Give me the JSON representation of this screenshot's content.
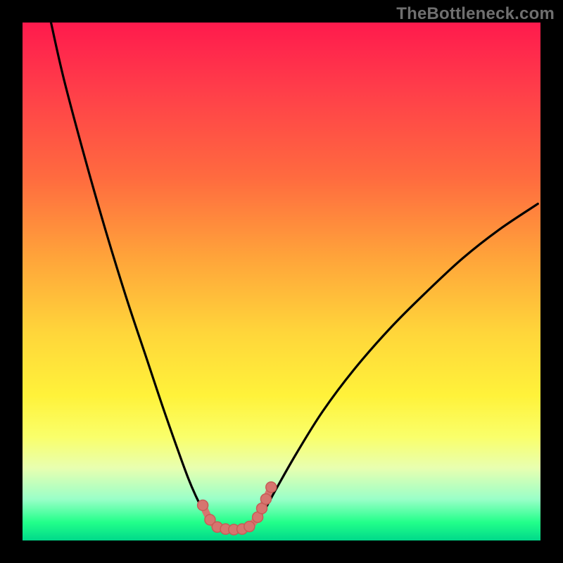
{
  "watermark": "TheBottleneck.com",
  "colors": {
    "curve": "#000000",
    "markers_fill": "#d6756f",
    "markers_stroke": "#c75c57",
    "marker_line": "#d6756f"
  },
  "chart_data": {
    "type": "line",
    "title": "",
    "xlabel": "",
    "ylabel": "",
    "xlim": [
      0,
      100
    ],
    "ylim": [
      0,
      100
    ],
    "grid": false,
    "series": [
      {
        "name": "left-branch",
        "x": [
          5.5,
          8,
          12,
          16,
          20,
          24,
          27,
          29.8,
          32,
          33.5,
          35,
          36.2,
          37.5
        ],
        "y": [
          100,
          89,
          74,
          60,
          47,
          35,
          26,
          18,
          12,
          8.5,
          5.5,
          3.5,
          2.5
        ]
      },
      {
        "name": "floor",
        "x": [
          37.5,
          38.5,
          40,
          41.5,
          43,
          44.5
        ],
        "y": [
          2.5,
          2.2,
          2.1,
          2.1,
          2.2,
          2.8
        ]
      },
      {
        "name": "right-branch",
        "x": [
          44.5,
          46.5,
          49,
          53,
          58,
          64,
          71,
          78,
          85,
          92,
          99.5
        ],
        "y": [
          2.8,
          5.5,
          10,
          17,
          25,
          33,
          41,
          48,
          54.5,
          60,
          65
        ]
      }
    ],
    "markers": {
      "name": "highlight-points",
      "x": [
        34.8,
        36.2,
        37.6,
        39.2,
        40.8,
        42.4,
        43.8,
        45.4,
        46.2,
        47.0,
        48.0
      ],
      "y": [
        6.8,
        4.0,
        2.6,
        2.2,
        2.1,
        2.2,
        2.7,
        4.5,
        6.2,
        8.0,
        10.3
      ]
    }
  }
}
